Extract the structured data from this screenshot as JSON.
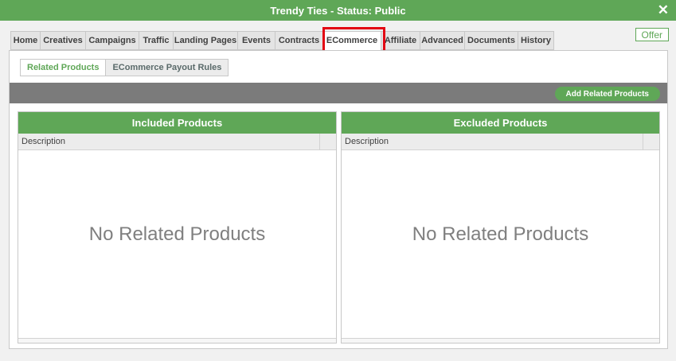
{
  "window": {
    "title": "Trendy Ties - Status: Public",
    "close_glyph": "✕"
  },
  "tabs": [
    {
      "label": "Home",
      "active": false
    },
    {
      "label": "Creatives",
      "active": false
    },
    {
      "label": "Campaigns",
      "active": false
    },
    {
      "label": "Traffic",
      "active": false
    },
    {
      "label": "Landing Pages",
      "active": false
    },
    {
      "label": "Events",
      "active": false
    },
    {
      "label": "Contracts",
      "active": false
    },
    {
      "label": "ECommerce",
      "active": true
    },
    {
      "label": "Affiliate",
      "active": false
    },
    {
      "label": "Advanced",
      "active": false
    },
    {
      "label": "Documents",
      "active": false
    },
    {
      "label": "History",
      "active": false
    }
  ],
  "offer_button": "Offer",
  "subtabs": [
    {
      "label": "Related Products",
      "active": true
    },
    {
      "label": "ECommerce Payout Rules",
      "active": false
    }
  ],
  "toolbar": {
    "add_button": "Add Related Products"
  },
  "included": {
    "title": "Included Products",
    "column": "Description",
    "empty": "No Related Products"
  },
  "excluded": {
    "title": "Excluded Products",
    "column": "Description",
    "empty": "No Related Products"
  },
  "colors": {
    "accent": "#5fa757",
    "highlight": "#e30613",
    "toolbar": "#7b7b7b"
  }
}
